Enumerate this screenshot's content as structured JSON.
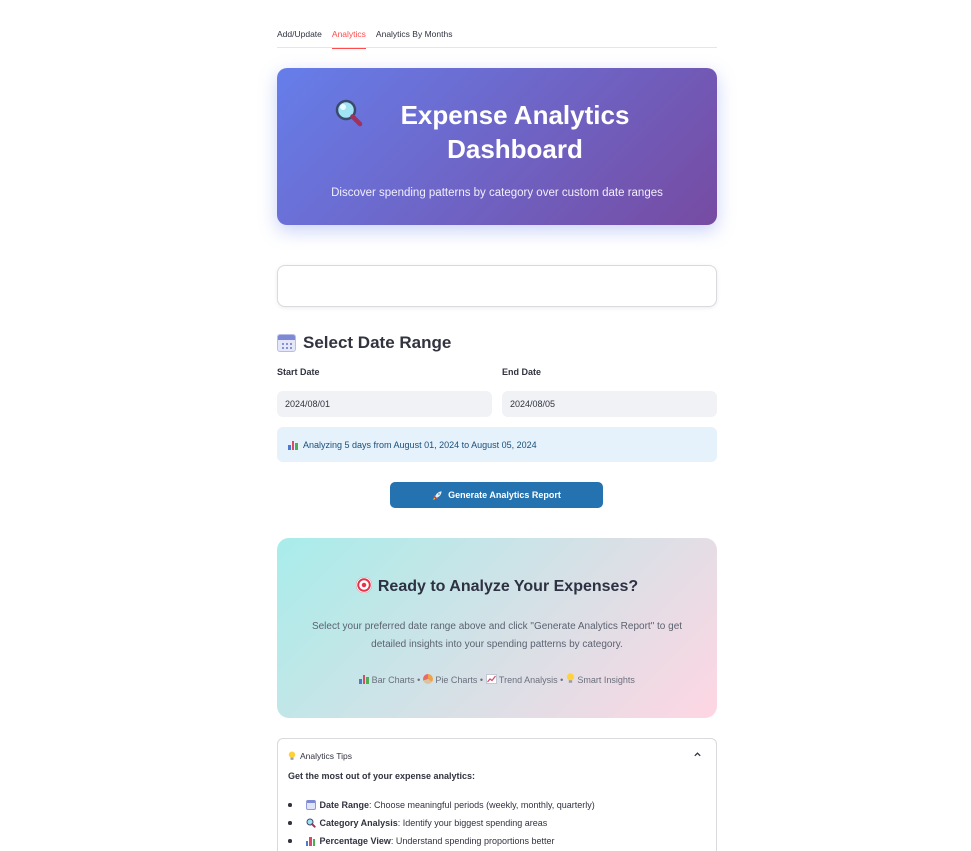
{
  "tabs": [
    {
      "label": "Add/Update",
      "active": false
    },
    {
      "label": "Analytics",
      "active": true
    },
    {
      "label": "Analytics By Months",
      "active": false
    }
  ],
  "hero": {
    "icon": "magnifier-icon",
    "title": "Expense Analytics Dashboard",
    "subtitle": "Discover spending patterns by category over custom date ranges"
  },
  "date_section": {
    "icon": "calendar-icon",
    "title": "Select Date Range",
    "start_label": "Start Date",
    "start_value": "2024/08/01",
    "end_label": "End Date",
    "end_value": "2024/08/05",
    "info_text": "Analyzing 5 days from August 01, 2024 to August 05, 2024"
  },
  "generate_button": {
    "icon": "rocket-icon",
    "label": "Generate Analytics Report"
  },
  "ready_card": {
    "icon": "target-icon",
    "title": "Ready to Analyze Your Expenses?",
    "description": "Select your preferred date range above and click \"Generate Analytics Report\" to get detailed insights into your spending patterns by category.",
    "features": [
      {
        "icon": "bar-chart-icon",
        "label": "Bar Charts"
      },
      {
        "icon": "pie-chart-icon",
        "label": "Pie Charts"
      },
      {
        "icon": "trend-chart-icon",
        "label": "Trend Analysis"
      },
      {
        "icon": "lightbulb-icon",
        "label": "Smart Insights"
      }
    ],
    "separator": "•"
  },
  "tips": {
    "icon": "lightbulb-icon",
    "header": "Analytics Tips",
    "expanded": true,
    "intro": "Get the most out of your expense analytics:",
    "items": [
      {
        "icon": "calendar-icon",
        "bold": "Date Range",
        "text": ": Choose meaningful periods (weekly, monthly, quarterly)"
      },
      {
        "icon": "magnifier-icon",
        "bold": "Category Analysis",
        "text": ": Identify your biggest spending areas"
      },
      {
        "icon": "bar-chart-icon",
        "bold": "Percentage View",
        "text": ": Understand spending proportions better"
      }
    ]
  },
  "colors": {
    "tab_active": "#ff4b4b",
    "hero_gradient_start": "#667eea",
    "hero_gradient_end": "#764ba2",
    "button": "#2472b0",
    "info_bg": "#e5f1fb",
    "ready_gradient_start": "#a8edea",
    "ready_gradient_end": "#fed6e3"
  }
}
